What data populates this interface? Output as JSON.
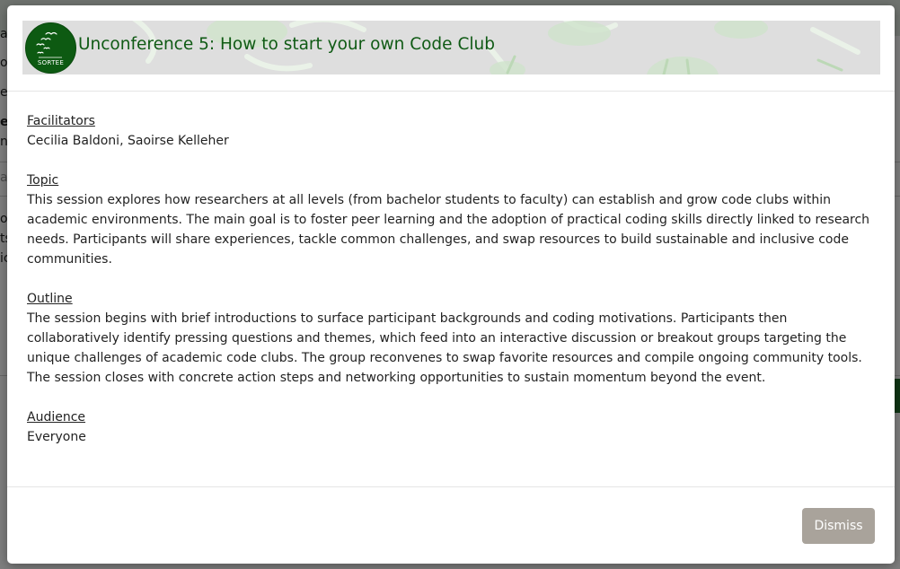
{
  "background_page": {
    "fragments": [
      "a",
      "o",
      "e",
      "el",
      "n",
      "a",
      "o",
      "ts",
      "ic"
    ]
  },
  "modal": {
    "logo": {
      "text": "SORTEE"
    },
    "title": "Unconference 5: How to start your own Code Club",
    "sections": [
      {
        "heading": "Facilitators",
        "text": "Cecilia Baldoni, Saoirse Kelleher"
      },
      {
        "heading": "Topic",
        "text": "This session explores how researchers at all levels (from bachelor students to faculty) can establish and grow code clubs within academic environments. The main goal is to foster peer learning and the adoption of practical coding skills directly linked to research needs. Participants will share experiences, tackle common challenges, and swap resources to build sustainable and inclusive code communities."
      },
      {
        "heading": "Outline",
        "text": "The session begins with brief introductions to surface participant backgrounds and coding motivations. Participants then collaboratively identify pressing questions and themes, which feed into an interactive discussion or breakout groups targeting the unique challenges of academic code clubs. The group reconvenes to swap favorite resources and compile ongoing community tools. The session closes with concrete action steps and networking opportunities to sustain momentum beyond the event."
      },
      {
        "heading": "Audience",
        "text": "Everyone"
      }
    ],
    "dismiss_label": "Dismiss"
  },
  "colors": {
    "title": "#0f5a14",
    "logo_bg": "#0d5a12",
    "dismiss_bg": "#a9a39b",
    "banner_bg": "#dedede"
  }
}
